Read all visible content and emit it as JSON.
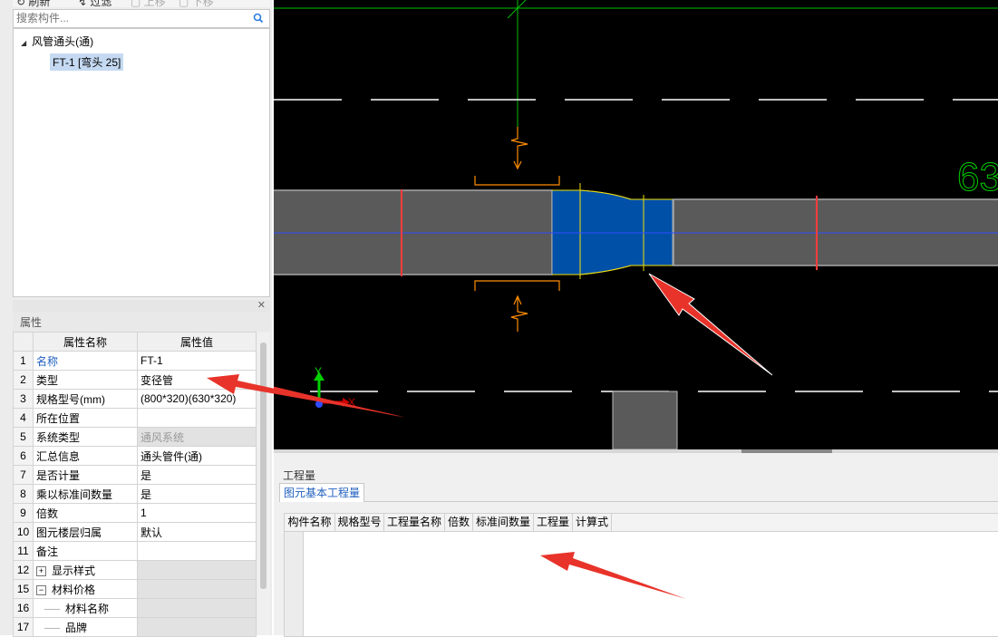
{
  "toolbar": {
    "items": [
      "刷新",
      "过滤",
      "上移",
      "下移"
    ]
  },
  "search": {
    "placeholder": "搜索构件..."
  },
  "tree": {
    "root": "风管通头(通)",
    "child": "FT-1 [弯头 25]"
  },
  "properties": {
    "title": "属性",
    "col_name": "属性名称",
    "col_value": "属性值",
    "rows": [
      {
        "n": "1",
        "name": "名称",
        "value": "FT-1"
      },
      {
        "n": "2",
        "name": "类型",
        "value": "变径管"
      },
      {
        "n": "3",
        "name": "规格型号(mm)",
        "value": "(800*320)(630*320)"
      },
      {
        "n": "4",
        "name": "所在位置",
        "value": ""
      },
      {
        "n": "5",
        "name": "系统类型",
        "value": "通风系统"
      },
      {
        "n": "6",
        "name": "汇总信息",
        "value": "通头管件(通)"
      },
      {
        "n": "7",
        "name": "是否计量",
        "value": "是"
      },
      {
        "n": "8",
        "name": "乘以标准间数量",
        "value": "是"
      },
      {
        "n": "9",
        "name": "倍数",
        "value": "1"
      },
      {
        "n": "10",
        "name": "图元楼层归属",
        "value": "默认"
      },
      {
        "n": "11",
        "name": "备注",
        "value": ""
      },
      {
        "n": "12",
        "name": "显示样式",
        "value": ""
      },
      {
        "n": "15",
        "name": "材料价格",
        "value": ""
      },
      {
        "n": "16",
        "name": "材料名称",
        "value": ""
      },
      {
        "n": "17",
        "name": "品牌",
        "value": ""
      }
    ]
  },
  "cad": {
    "dimension_text": "63",
    "axis_x": "X",
    "axis_y": "Y",
    "colors": {
      "background": "#000000",
      "duct": "#5a5a5a",
      "selected": "#0050a8",
      "centerline": "#2f4cff",
      "marker": "#ff3b3b",
      "section": "#ff8c00",
      "grid": "#00c000"
    }
  },
  "quantities": {
    "title": "工程量",
    "tab": "图元基本工程量",
    "columns": [
      "构件名称",
      "规格型号",
      "工程量名称",
      "倍数",
      "标准间数量",
      "工程量",
      "计算式"
    ]
  }
}
